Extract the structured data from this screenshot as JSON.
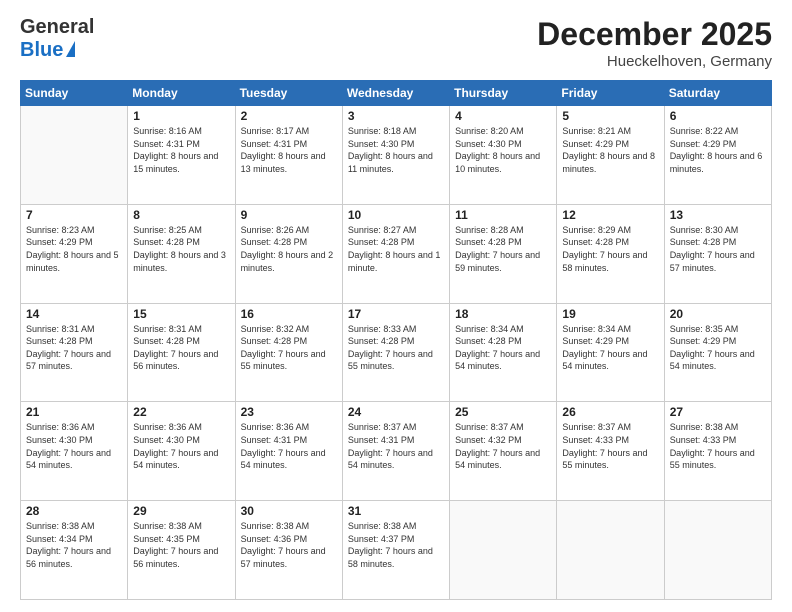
{
  "header": {
    "logo_general": "General",
    "logo_blue": "Blue",
    "month_title": "December 2025",
    "location": "Hueckelhoven, Germany"
  },
  "days_of_week": [
    "Sunday",
    "Monday",
    "Tuesday",
    "Wednesday",
    "Thursday",
    "Friday",
    "Saturday"
  ],
  "weeks": [
    [
      {
        "day": "",
        "sunrise": "",
        "sunset": "",
        "daylight": ""
      },
      {
        "day": "1",
        "sunrise": "Sunrise: 8:16 AM",
        "sunset": "Sunset: 4:31 PM",
        "daylight": "Daylight: 8 hours and 15 minutes."
      },
      {
        "day": "2",
        "sunrise": "Sunrise: 8:17 AM",
        "sunset": "Sunset: 4:31 PM",
        "daylight": "Daylight: 8 hours and 13 minutes."
      },
      {
        "day": "3",
        "sunrise": "Sunrise: 8:18 AM",
        "sunset": "Sunset: 4:30 PM",
        "daylight": "Daylight: 8 hours and 11 minutes."
      },
      {
        "day": "4",
        "sunrise": "Sunrise: 8:20 AM",
        "sunset": "Sunset: 4:30 PM",
        "daylight": "Daylight: 8 hours and 10 minutes."
      },
      {
        "day": "5",
        "sunrise": "Sunrise: 8:21 AM",
        "sunset": "Sunset: 4:29 PM",
        "daylight": "Daylight: 8 hours and 8 minutes."
      },
      {
        "day": "6",
        "sunrise": "Sunrise: 8:22 AM",
        "sunset": "Sunset: 4:29 PM",
        "daylight": "Daylight: 8 hours and 6 minutes."
      }
    ],
    [
      {
        "day": "7",
        "sunrise": "Sunrise: 8:23 AM",
        "sunset": "Sunset: 4:29 PM",
        "daylight": "Daylight: 8 hours and 5 minutes."
      },
      {
        "day": "8",
        "sunrise": "Sunrise: 8:25 AM",
        "sunset": "Sunset: 4:28 PM",
        "daylight": "Daylight: 8 hours and 3 minutes."
      },
      {
        "day": "9",
        "sunrise": "Sunrise: 8:26 AM",
        "sunset": "Sunset: 4:28 PM",
        "daylight": "Daylight: 8 hours and 2 minutes."
      },
      {
        "day": "10",
        "sunrise": "Sunrise: 8:27 AM",
        "sunset": "Sunset: 4:28 PM",
        "daylight": "Daylight: 8 hours and 1 minute."
      },
      {
        "day": "11",
        "sunrise": "Sunrise: 8:28 AM",
        "sunset": "Sunset: 4:28 PM",
        "daylight": "Daylight: 7 hours and 59 minutes."
      },
      {
        "day": "12",
        "sunrise": "Sunrise: 8:29 AM",
        "sunset": "Sunset: 4:28 PM",
        "daylight": "Daylight: 7 hours and 58 minutes."
      },
      {
        "day": "13",
        "sunrise": "Sunrise: 8:30 AM",
        "sunset": "Sunset: 4:28 PM",
        "daylight": "Daylight: 7 hours and 57 minutes."
      }
    ],
    [
      {
        "day": "14",
        "sunrise": "Sunrise: 8:31 AM",
        "sunset": "Sunset: 4:28 PM",
        "daylight": "Daylight: 7 hours and 57 minutes."
      },
      {
        "day": "15",
        "sunrise": "Sunrise: 8:31 AM",
        "sunset": "Sunset: 4:28 PM",
        "daylight": "Daylight: 7 hours and 56 minutes."
      },
      {
        "day": "16",
        "sunrise": "Sunrise: 8:32 AM",
        "sunset": "Sunset: 4:28 PM",
        "daylight": "Daylight: 7 hours and 55 minutes."
      },
      {
        "day": "17",
        "sunrise": "Sunrise: 8:33 AM",
        "sunset": "Sunset: 4:28 PM",
        "daylight": "Daylight: 7 hours and 55 minutes."
      },
      {
        "day": "18",
        "sunrise": "Sunrise: 8:34 AM",
        "sunset": "Sunset: 4:28 PM",
        "daylight": "Daylight: 7 hours and 54 minutes."
      },
      {
        "day": "19",
        "sunrise": "Sunrise: 8:34 AM",
        "sunset": "Sunset: 4:29 PM",
        "daylight": "Daylight: 7 hours and 54 minutes."
      },
      {
        "day": "20",
        "sunrise": "Sunrise: 8:35 AM",
        "sunset": "Sunset: 4:29 PM",
        "daylight": "Daylight: 7 hours and 54 minutes."
      }
    ],
    [
      {
        "day": "21",
        "sunrise": "Sunrise: 8:36 AM",
        "sunset": "Sunset: 4:30 PM",
        "daylight": "Daylight: 7 hours and 54 minutes."
      },
      {
        "day": "22",
        "sunrise": "Sunrise: 8:36 AM",
        "sunset": "Sunset: 4:30 PM",
        "daylight": "Daylight: 7 hours and 54 minutes."
      },
      {
        "day": "23",
        "sunrise": "Sunrise: 8:36 AM",
        "sunset": "Sunset: 4:31 PM",
        "daylight": "Daylight: 7 hours and 54 minutes."
      },
      {
        "day": "24",
        "sunrise": "Sunrise: 8:37 AM",
        "sunset": "Sunset: 4:31 PM",
        "daylight": "Daylight: 7 hours and 54 minutes."
      },
      {
        "day": "25",
        "sunrise": "Sunrise: 8:37 AM",
        "sunset": "Sunset: 4:32 PM",
        "daylight": "Daylight: 7 hours and 54 minutes."
      },
      {
        "day": "26",
        "sunrise": "Sunrise: 8:37 AM",
        "sunset": "Sunset: 4:33 PM",
        "daylight": "Daylight: 7 hours and 55 minutes."
      },
      {
        "day": "27",
        "sunrise": "Sunrise: 8:38 AM",
        "sunset": "Sunset: 4:33 PM",
        "daylight": "Daylight: 7 hours and 55 minutes."
      }
    ],
    [
      {
        "day": "28",
        "sunrise": "Sunrise: 8:38 AM",
        "sunset": "Sunset: 4:34 PM",
        "daylight": "Daylight: 7 hours and 56 minutes."
      },
      {
        "day": "29",
        "sunrise": "Sunrise: 8:38 AM",
        "sunset": "Sunset: 4:35 PM",
        "daylight": "Daylight: 7 hours and 56 minutes."
      },
      {
        "day": "30",
        "sunrise": "Sunrise: 8:38 AM",
        "sunset": "Sunset: 4:36 PM",
        "daylight": "Daylight: 7 hours and 57 minutes."
      },
      {
        "day": "31",
        "sunrise": "Sunrise: 8:38 AM",
        "sunset": "Sunset: 4:37 PM",
        "daylight": "Daylight: 7 hours and 58 minutes."
      },
      {
        "day": "",
        "sunrise": "",
        "sunset": "",
        "daylight": ""
      },
      {
        "day": "",
        "sunrise": "",
        "sunset": "",
        "daylight": ""
      },
      {
        "day": "",
        "sunrise": "",
        "sunset": "",
        "daylight": ""
      }
    ]
  ]
}
